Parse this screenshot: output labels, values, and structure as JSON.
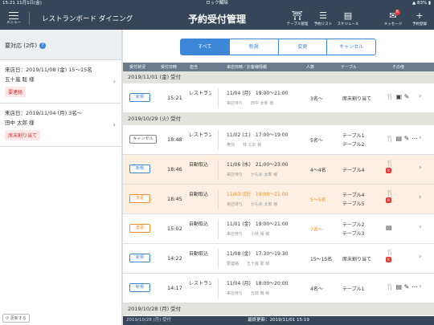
{
  "status": {
    "time": "15:21",
    "date": "11月1日(金)",
    "lock": "ロック解除",
    "battery": "83%"
  },
  "header": {
    "menu": "メニュー",
    "store": "レストランボード ダイニング",
    "title": "予約受付管理",
    "tools": [
      {
        "icon": "table-icon",
        "glyph": "⛩",
        "label": "テーブル管理"
      },
      {
        "icon": "list-icon",
        "glyph": "☰",
        "label": "予約リスト"
      },
      {
        "icon": "schedule-icon",
        "glyph": "▤",
        "label": "スケジュール"
      },
      {
        "icon": "message-icon",
        "glyph": "✉",
        "label": "メッセージ",
        "badge": "6"
      },
      {
        "icon": "plus-icon",
        "glyph": "+",
        "label": "予約登録"
      }
    ]
  },
  "left": {
    "title": "要対応 (2件)",
    "help": "?",
    "refresh": "更新する",
    "cards": [
      {
        "line1": "来店日：2019/11/08 (金) 15〜15名",
        "line2": "五十嵐 聡 様",
        "tag": "要連絡"
      },
      {
        "line1": "来店日：2019/11/04 (月) 3名〜",
        "line2": "田中 太郎 様",
        "tag": "席未割り当て"
      }
    ]
  },
  "tabs": [
    "すべて",
    "新規",
    "変更",
    "キャンセル"
  ],
  "columns": [
    "受付状況",
    "受付日時",
    "担当",
    "来店日時／お客様情報",
    "人数",
    "テーブル",
    "その他"
  ],
  "groups": [
    {
      "date": "2019/11/01 (金) 受付",
      "rows": [
        {
          "status": "新規",
          "status_type": "new",
          "time": "15:21",
          "route": "レストラン ボード・・・",
          "date": "11/04 (月)",
          "times": "19:00〜21:00",
          "note": "来店待ち",
          "guest": "田中 太郎 様",
          "people": "3名〜",
          "tables": [
            "席未割り当て"
          ],
          "others": "🍴 ▣ ✎",
          "highlight": false,
          "orange": false
        }
      ]
    },
    {
      "date": "2019/10/29 (火) 受付",
      "rows": [
        {
          "status": "キャンセル",
          "status_type": "cancel",
          "time": "18:48",
          "route": "レストラン ボード・・・",
          "date": "11/02 (土)",
          "times": "17:00〜19:00",
          "note": "無効",
          "guest": "林 なお 様",
          "people": "5名〜",
          "tables": [
            "テーブル1",
            "テーブル2"
          ],
          "others": "🍴 ▤ ✎ ⋯",
          "highlight": false,
          "orange": false
        },
        {
          "status": "新規",
          "status_type": "new",
          "time": "18:46",
          "route": "自動取込",
          "date": "11/06 (水)",
          "times": "21:00〜23:00",
          "note": "来店待ち",
          "guest": "かもめ 太郎 様",
          "people": "4〜4名",
          "tables": [
            "テーブル4"
          ],
          "others": "🍴",
          "rr": "R",
          "highlight": true,
          "orange": false
        },
        {
          "status": "変更",
          "status_type": "change",
          "time": "18:45",
          "route": "自動取込",
          "date": "11/03 (日)",
          "times": "19:00〜21:00",
          "note": "来店待ち",
          "guest": "かもめ 太郎 様",
          "people": "5〜5名",
          "tables": [
            "テーブル4",
            "テーブル5"
          ],
          "others": "🍴",
          "rr": "R",
          "highlight": true,
          "orange": true
        },
        {
          "status": "変更",
          "status_type": "change",
          "time": "15:02",
          "route": "自動取込",
          "date": "11/01 (金)",
          "times": "19:00〜21:00",
          "note": "来店待ち",
          "guest": "小林 晴 様",
          "people": "7名〜",
          "tables": [
            "テーブル2",
            "テーブル3"
          ],
          "others": "▤",
          "highlight": false,
          "orange": false,
          "people_orange": true
        },
        {
          "status": "新規",
          "status_type": "new",
          "time": "14:22",
          "route": "自動取込",
          "date": "11/08 (金)",
          "times": "17:30〜19:30",
          "note": "要連絡",
          "guest": "五十嵐 聡 様",
          "people": "15〜15名",
          "tables": [
            "席未割り当て"
          ],
          "others": "🍴",
          "rr": "R",
          "highlight": false,
          "orange": false
        },
        {
          "status": "新規",
          "status_type": "new",
          "time": "14:17",
          "route": "レストラン ボード・・・",
          "date": "11/04 (月)",
          "times": "18:00〜20:00",
          "note": "来店待ち",
          "guest": "五郎 暁 様",
          "people": "4名〜",
          "tables": [
            "テーブル1"
          ],
          "others": "🍴 ▤ ✎ ⋯",
          "highlight": false,
          "orange": false
        }
      ]
    },
    {
      "date": "2019/10/28 (月) 受付",
      "rows": []
    }
  ],
  "footer": {
    "last_update": "最終更新：2019/11/01 15:19"
  }
}
